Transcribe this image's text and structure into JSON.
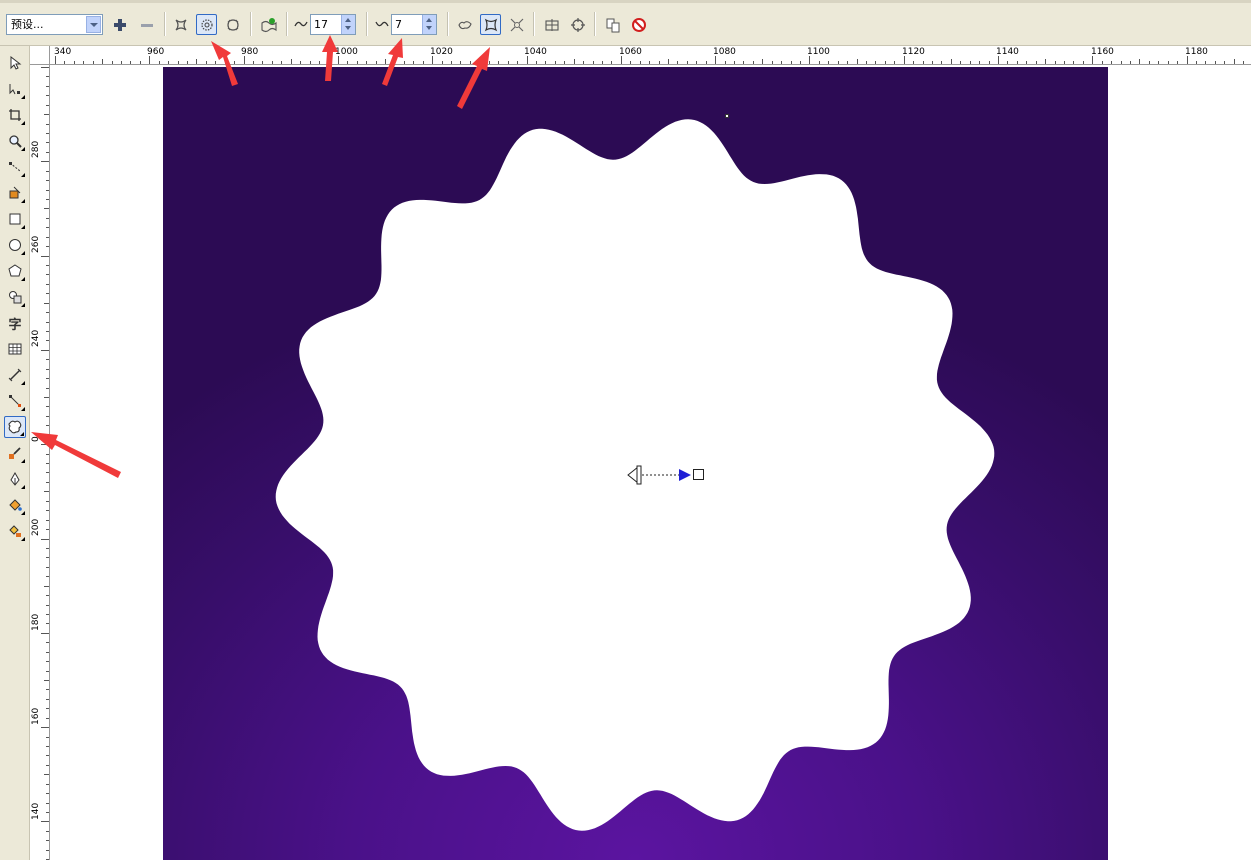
{
  "property_bar": {
    "preset": "预设...",
    "add_preset_icon": "plus-icon",
    "remove_preset_icon": "minus-icon",
    "distortion_modes": [
      "push-pull-distortion-icon",
      "zipper-distortion-icon",
      "twister-distortion-icon"
    ],
    "active_mode": "zipper-distortion-icon",
    "amplitude": "17",
    "frequency": "7",
    "effects": [
      "random-distortion-icon",
      "smooth-distortion-icon",
      "local-distortion-icon"
    ],
    "active_effect": "smooth-distortion-icon"
  },
  "toolbox": {
    "text_tool_glyph": "字",
    "active_tool": "interactive-distortion-tool"
  },
  "h_ruler": {
    "labels": [
      "340",
      "960",
      "980",
      "1000",
      "1020",
      "1040",
      "1060",
      "1080",
      "1100",
      "1120",
      "1140",
      "1160",
      "1180"
    ]
  },
  "v_ruler": {
    "labels": [
      "280",
      "260",
      "240",
      "0",
      "200",
      "180",
      "160",
      "140"
    ]
  },
  "canvas": {
    "background_color": "#ffffff",
    "shape_color": "#ffffff",
    "artboard_colors": [
      "#5b14a0",
      "#370e69",
      "#2c0b54"
    ],
    "distortion_handle_color": "#1f1fd6"
  },
  "annotations": {
    "arrow_color": "#f03a3a"
  }
}
